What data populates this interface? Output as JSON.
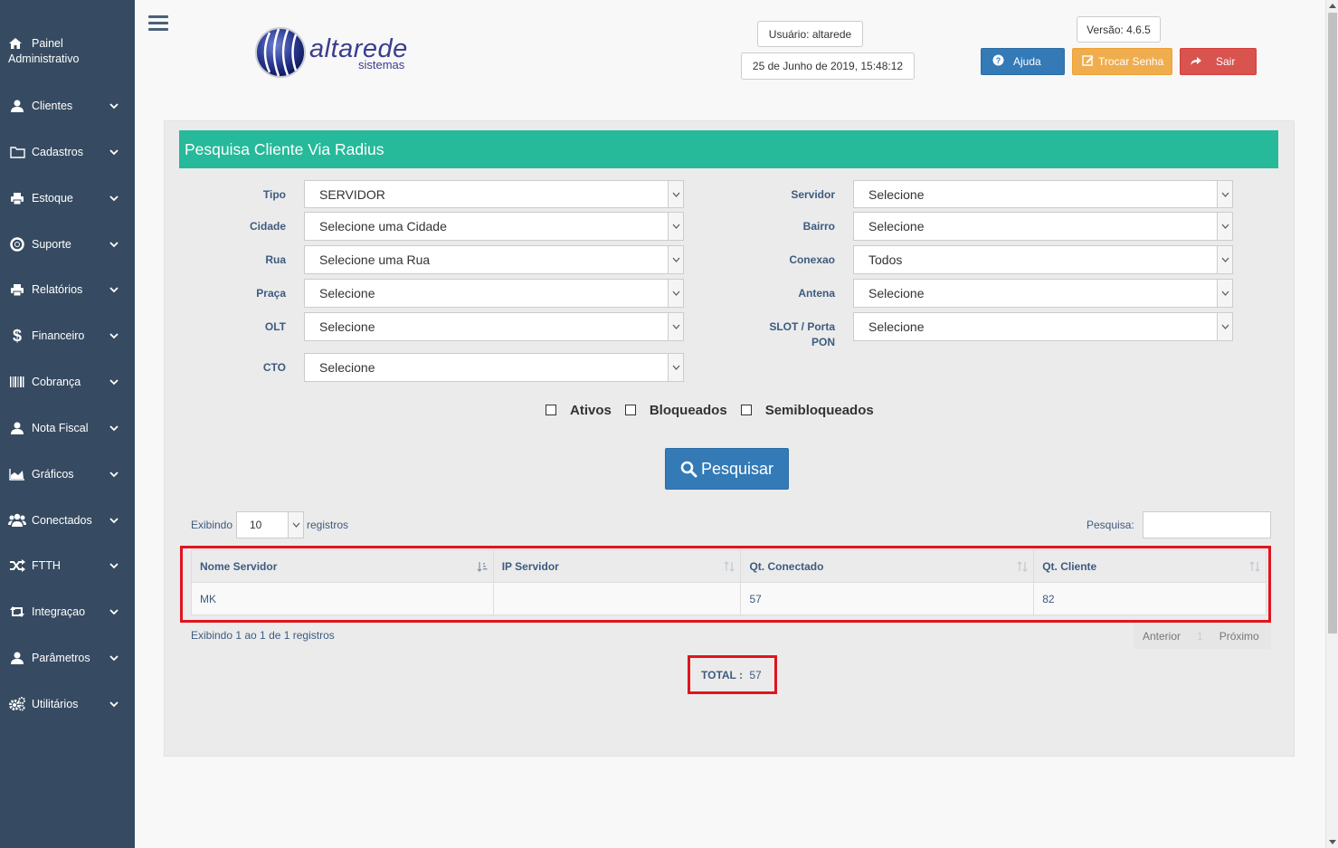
{
  "sidebar": {
    "top_label_1": "Painel",
    "top_label_2": "Administrativo",
    "items": [
      {
        "label": "Clientes"
      },
      {
        "label": "Cadastros"
      },
      {
        "label": "Estoque"
      },
      {
        "label": "Suporte"
      },
      {
        "label": "Relatórios"
      },
      {
        "label": "Financeiro"
      },
      {
        "label": "Cobrança"
      },
      {
        "label": "Nota Fiscal"
      },
      {
        "label": "Gráficos"
      },
      {
        "label": "Conectados"
      },
      {
        "label": "FTTH"
      },
      {
        "label": "Integraçao"
      },
      {
        "label": "Parâmetros"
      },
      {
        "label": "Utilitários"
      }
    ]
  },
  "header": {
    "logo_text": "altarede",
    "logo_sub": "sistemas",
    "user": "Usuário: altarede",
    "datetime": "25 de Junho de 2019, 15:48:12",
    "version": "Versão: 4.6.5",
    "help_label": "Ajuda",
    "change_pw_label": "Trocar Senha",
    "logout_label": "Sair",
    "colors": {
      "help": "#337ab7",
      "change_pw": "#f0ad4e",
      "logout": "#d9534f"
    }
  },
  "panel": {
    "title": "Pesquisa Cliente Via Radius",
    "fields": {
      "tipo": {
        "label": "Tipo",
        "value": "SERVIDOR"
      },
      "cidade": {
        "label": "Cidade",
        "value": "Selecione uma Cidade"
      },
      "rua": {
        "label": "Rua",
        "value": "Selecione uma Rua"
      },
      "praca": {
        "label": "Praça",
        "value": "Selecione"
      },
      "olt": {
        "label": "OLT",
        "value": "Selecione"
      },
      "cto": {
        "label": "CTO",
        "value": "Selecione"
      },
      "servidor": {
        "label": "Servidor",
        "value": "Selecione"
      },
      "bairro": {
        "label": "Bairro",
        "value": "Selecione"
      },
      "conexao": {
        "label": "Conexao",
        "value": "Todos"
      },
      "antena": {
        "label": "Antena",
        "value": "Selecione"
      },
      "slot_label_1": "SLOT / Porta",
      "slot_label_2": "PON",
      "slot_value": "Selecione"
    },
    "checkboxes": {
      "ativos": "Ativos",
      "bloqueados": "Bloqueados",
      "semibloqueados": "Semibloqueados"
    },
    "search_button": "Pesquisar"
  },
  "table": {
    "length_prefix": "Exibindo",
    "length_value": "10",
    "length_suffix": "registros",
    "search_label": "Pesquisa:",
    "headers": [
      "Nome Servidor",
      "IP Servidor",
      "Qt. Conectado",
      "Qt. Cliente"
    ],
    "rows": [
      {
        "nome": "MK",
        "ip": "",
        "conectado": "57",
        "cliente": "82"
      }
    ],
    "info": "Exibindo 1 ao 1 de 1 registros",
    "pager": {
      "prev": "Anterior",
      "page": "1",
      "next": "Próximo"
    },
    "total_label": "TOTAL :",
    "total_value": "57"
  }
}
